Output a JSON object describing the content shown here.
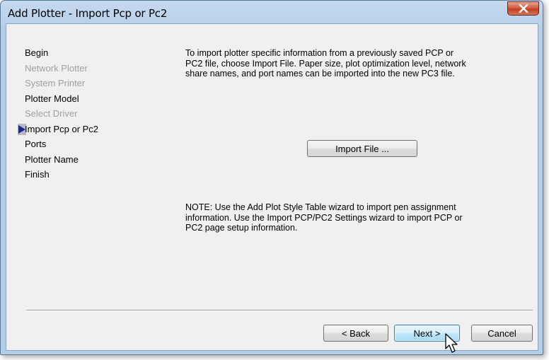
{
  "window": {
    "title": "Add Plotter - Import Pcp or Pc2"
  },
  "steps": [
    {
      "label": "Begin",
      "enabled": true,
      "current": false
    },
    {
      "label": "Network Plotter",
      "enabled": false,
      "current": false
    },
    {
      "label": "System Printer",
      "enabled": false,
      "current": false
    },
    {
      "label": "Plotter Model",
      "enabled": true,
      "current": false
    },
    {
      "label": "Select Driver",
      "enabled": false,
      "current": false
    },
    {
      "label": "Import Pcp or Pc2",
      "enabled": true,
      "current": true
    },
    {
      "label": "Ports",
      "enabled": true,
      "current": false
    },
    {
      "label": "Plotter Name",
      "enabled": true,
      "current": false
    },
    {
      "label": "Finish",
      "enabled": true,
      "current": false
    }
  ],
  "content": {
    "description": "To import plotter specific information from a previously saved PCP or PC2 file, choose Import File. Paper size, plot optimization level, network share names, and port names can be imported into the new PC3 file.",
    "import_button": "Import File ...",
    "note": "NOTE: Use the Add Plot Style Table wizard to import pen assignment information. Use the Import PCP/PC2 Settings wizard to import PCP or PC2 page setup information."
  },
  "footer": {
    "back_label": "< Back",
    "next_label": "Next >",
    "cancel_label": "Cancel"
  },
  "icons": {
    "close": "close-icon",
    "current_step": "arrow-right-icon",
    "cursor": "mouse-pointer-icon"
  },
  "colors": {
    "titlebar": "#b9d1ea",
    "close_button": "#c2401f",
    "client_bg": "#f0f0f0",
    "disabled_text": "#a0a0a0",
    "step_arrow": "#1a2c8a"
  }
}
